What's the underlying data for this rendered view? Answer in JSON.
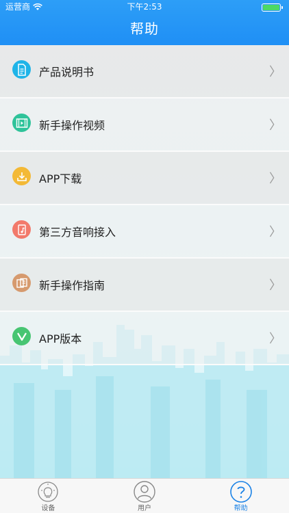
{
  "status_bar": {
    "carrier": "运营商",
    "time": "下午2:53"
  },
  "header": {
    "title": "帮助"
  },
  "menu": [
    {
      "label": "产品说明书",
      "icon": "document-icon",
      "color": "#1fb4e8"
    },
    {
      "label": "新手操作视频",
      "icon": "video-film-icon",
      "color": "#2fc39a"
    },
    {
      "label": "APP下载",
      "icon": "download-icon",
      "color": "#f3b936"
    },
    {
      "label": "第三方音响接入",
      "icon": "music-file-icon",
      "color": "#f27a6b"
    },
    {
      "label": "新手操作指南",
      "icon": "guide-book-icon",
      "color": "#d69a6e"
    },
    {
      "label": "APP版本",
      "icon": "version-v-icon",
      "color": "#47c572"
    }
  ],
  "tabs": [
    {
      "label": "设备",
      "icon": "lightbulb-icon",
      "active": false
    },
    {
      "label": "用户",
      "icon": "user-icon",
      "active": false
    },
    {
      "label": "帮助",
      "icon": "help-question-icon",
      "active": true
    }
  ],
  "colors": {
    "header_bg": "#2196f3",
    "active_tab": "#1a82e6",
    "battery": "#4cd964"
  }
}
